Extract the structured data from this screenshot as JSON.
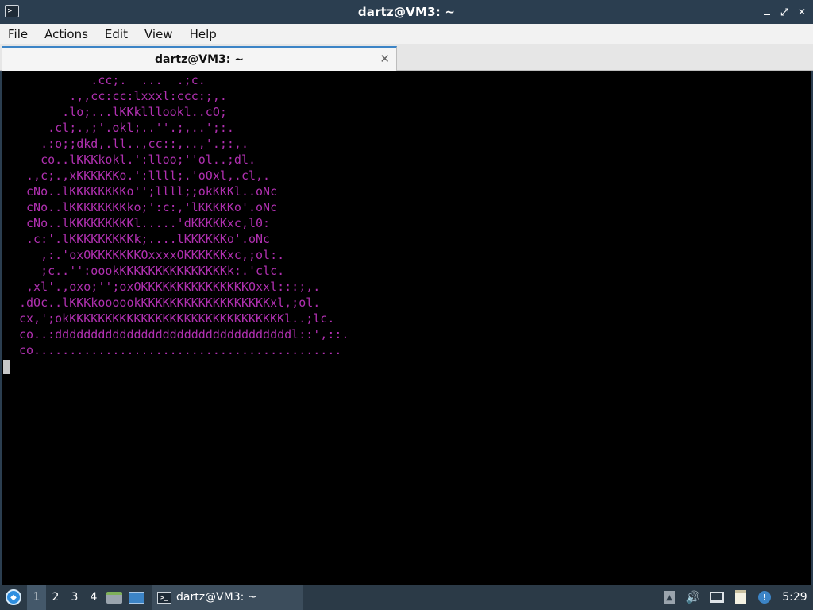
{
  "window": {
    "title": "dartz@VM3: ~",
    "app_icon_glyph": ">_",
    "controls": {
      "minimize": "",
      "maximize": "⤢",
      "close": "✕"
    }
  },
  "menu": [
    "File",
    "Actions",
    "Edit",
    "View",
    "Help"
  ],
  "tabs": [
    {
      "label": "dartz@VM3: ~",
      "close_glyph": "✕"
    }
  ],
  "terminal": {
    "text_color": "#b030b0",
    "lines": [
      "          .cc;.  ...  .;c.",
      "       .,,cc:cc:lxxxl:ccc:;,.",
      "      .lo;...lKKklllookl..cO;",
      "    .cl;.,;'.okl;..''.;,..';:.",
      "   .:o;;dkd,.ll..,cc::,..,'.;:,.",
      "   co..lKKKkokl.':lloo;''ol..;dl.",
      " .,c;.,xKKKKKKo.':llll;.'oOxl,.cl,.",
      " cNo..lKKKKKKKKo'';llll;;okKKKl..oNc",
      " cNo..lKKKKKKKKko;':c:,'lKKKKKo'.oNc",
      " cNo..lKKKKKKKKKl.....'dKKKKKxc,l0:",
      " .c:'.lKKKKKKKKKk;....lKKKKKKo'.oNc",
      "   ,:.'oxOKKKKKKKOxxxxOKKKKKKxc,;ol:.",
      "   ;c..'':oookKKKKKKKKKKKKKKKk:.'clc.",
      " ,xl'.,oxo;'';oxOKKKKKKKKKKKKKKKOxxl:::;,.",
      ".dOc..lKKKkoooookKKKKKKKKKKKKKKKKKKxl,;ol.",
      "cx,';okKKKKKKKKKKKKKKKKKKKKKKKKKKKKKKl..;lc.",
      "co..:dddddddddddddddddddddddddddddddddl::',::.",
      "co..........................................."
    ]
  },
  "taskbar": {
    "start_glyph": "◆",
    "workspaces": [
      "1",
      "2",
      "3",
      "4"
    ],
    "active_workspace": "1",
    "task_label": "dartz@VM3: ~",
    "tray": {
      "up_arrow": "▲",
      "volume": "🔊",
      "notify": "!"
    },
    "clock": "5:29"
  }
}
